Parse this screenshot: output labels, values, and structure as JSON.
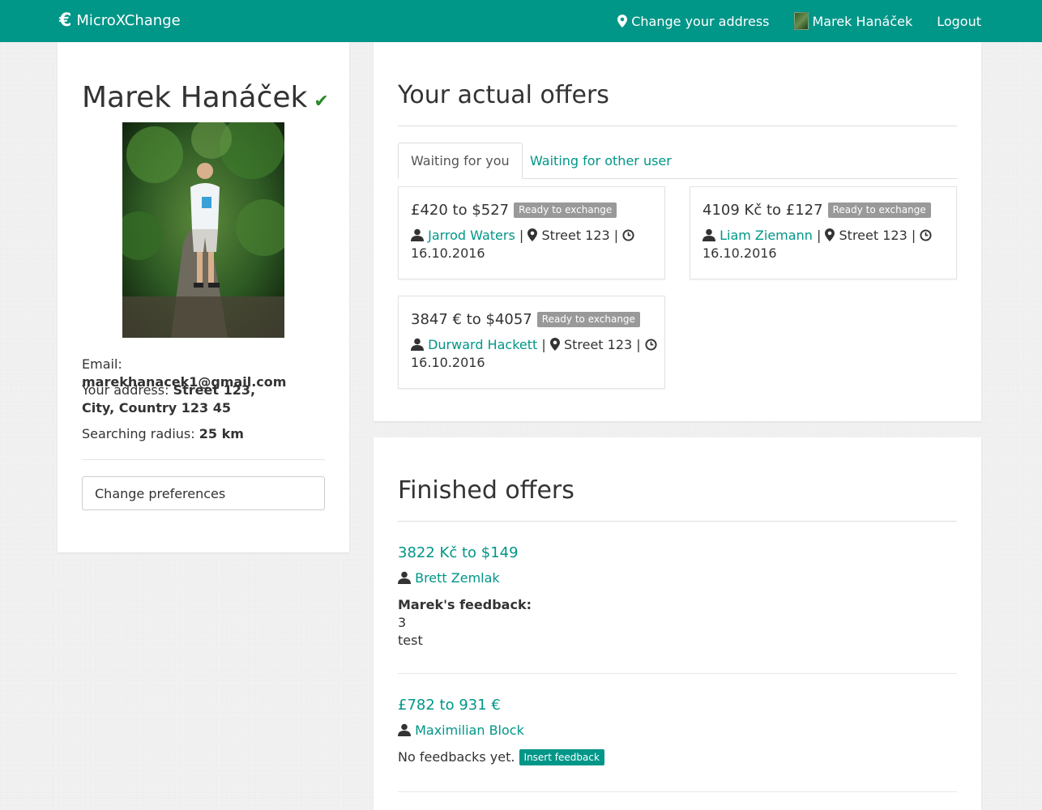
{
  "nav": {
    "brand": "MicroXChange",
    "brand_icon": "euro-icon",
    "change_address": "Change your address",
    "user_name": "Marek Hanáček",
    "logout": "Logout"
  },
  "profile": {
    "name": "Marek Hanáček",
    "email_label": "Email:",
    "email": "marekhanacek1@gmail.com",
    "address_label": "Your address:",
    "address": "Street 123, City, Country 123 45",
    "radius_label": "Searching radius:",
    "radius": "25 km",
    "change_pref": "Change preferences"
  },
  "actual": {
    "title": "Your actual offers",
    "tabs": [
      {
        "label": "Waiting for you",
        "active": true
      },
      {
        "label": "Waiting for other user",
        "active": false
      }
    ],
    "offers": [
      {
        "title": "£420 to $527",
        "status": "Ready to exchange",
        "user": "Jarrod Waters",
        "street": "Street 123",
        "date": "16.10.2016"
      },
      {
        "title": "4109 Kč to £127",
        "status": "Ready to exchange",
        "user": "Liam Ziemann",
        "street": "Street 123",
        "date": "16.10.2016"
      },
      {
        "title": "3847 € to $4057",
        "status": "Ready to exchange",
        "user": "Durward Hackett",
        "street": "Street 123",
        "date": "16.10.2016"
      }
    ]
  },
  "finished": {
    "title": "Finished offers",
    "items": [
      {
        "title": "3822 Kč to $149",
        "user": "Brett Zemlak",
        "feedback_label": "Marek's feedback:",
        "rating": "3",
        "comment": "test"
      },
      {
        "title": "£782 to 931 €",
        "user": "Maximilian Block",
        "no_feedback": "No feedbacks yet.",
        "insert_feedback": "Insert feedback"
      }
    ]
  },
  "colors": {
    "accent": "#009688",
    "badge": "#999999",
    "verified": "#2a8a2a"
  }
}
